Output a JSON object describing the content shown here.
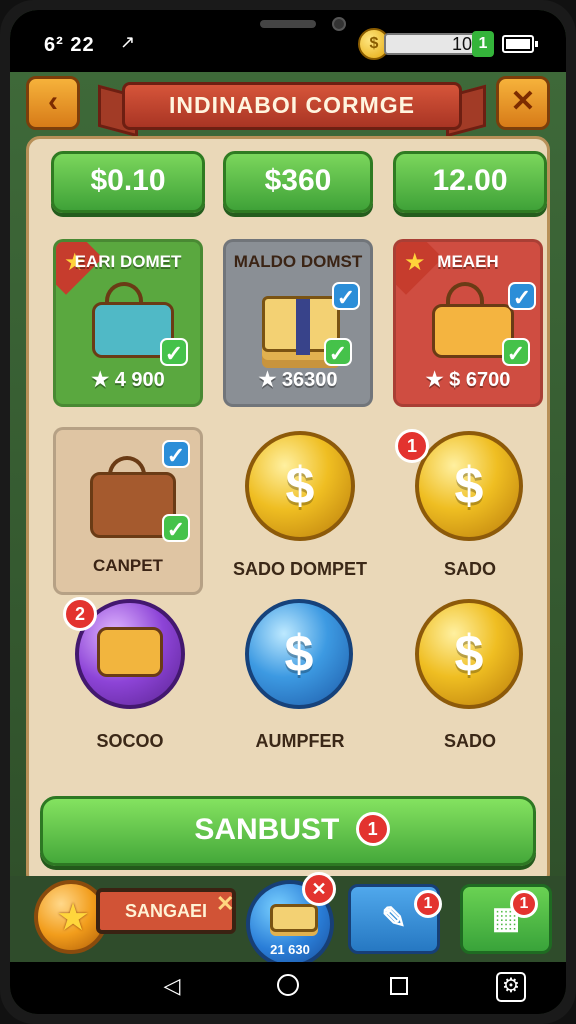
{
  "status": {
    "time": "6² 22",
    "navigation_glyph": "↗",
    "currency_value": "10",
    "currency_plus": "1",
    "coin_symbol": "$"
  },
  "header": {
    "title": "INDINABOI CORMGE",
    "back_icon": "‹",
    "close_icon": "✕"
  },
  "price_tabs": [
    {
      "label": "$0.10"
    },
    {
      "label": "$360"
    },
    {
      "label": "12.00"
    }
  ],
  "cards": [
    {
      "title": "EARI DOMET",
      "price": "★ 4 900",
      "icon": "blue-bag-icon"
    },
    {
      "title": "MALDO DOMST",
      "price": "★ 36300",
      "icon": "money-stack-icon"
    },
    {
      "title": "MEAEH",
      "price": "★ $ 6700",
      "icon": "golden-bag-icon"
    },
    {
      "title": "CANPET",
      "icon": "brown-bag-icon"
    }
  ],
  "coins": [
    {
      "label": "SADO DOMPET",
      "symbol": "$"
    },
    {
      "label": "SADO",
      "symbol": "$",
      "badge": "1"
    },
    {
      "label": "SOCOO",
      "symbol": "",
      "badge": "2"
    },
    {
      "label": "AUMPFER",
      "symbol": "$"
    },
    {
      "label": "SADO",
      "symbol": "$"
    }
  ],
  "main_action": {
    "label": "SANBUST",
    "badge": "1"
  },
  "bottom_bar": {
    "player_label": "SANGAEI",
    "player_close": "✕",
    "round_value": "21 630",
    "round_badge": "✕",
    "tool_badge": "1",
    "grid_badge": "1",
    "grid_icon": "▦",
    "tool_icon": "✎"
  },
  "nav": {
    "back": "◁",
    "settings": "⚙"
  },
  "colors": {
    "accent": "#45a83a",
    "title_red": "#c63c2d",
    "board_tan": "#ead8b8"
  }
}
